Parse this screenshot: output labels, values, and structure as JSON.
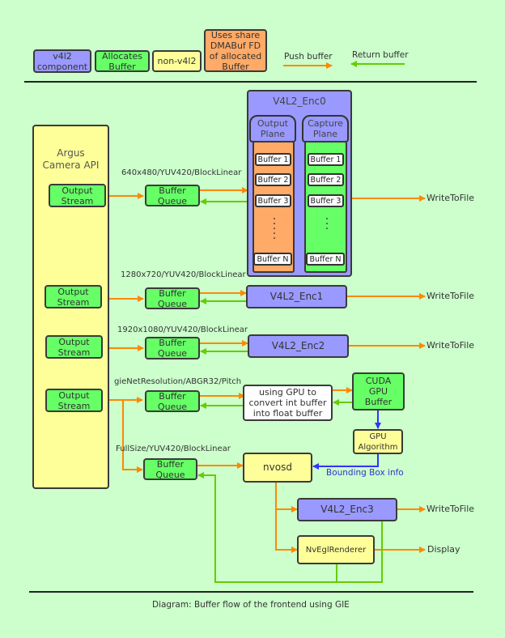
{
  "legend": {
    "v4l2": "v4l2\ncomponent",
    "allocates": "Allocates\nBuffer",
    "non_v4l2": "non-v4l2",
    "dmabuf": "Uses share\nDMABuf FD\nof allocated\nBuffer",
    "push": "Push buffer",
    "return": "Return buffer"
  },
  "colors": {
    "background": "#ccffcc",
    "v4l2": "#9999ff",
    "allocates": "#66ff66",
    "non_v4l2": "#ffff99",
    "dmabuf": "#ffaa66",
    "push_arrow": "#ff8800",
    "return_arrow": "#66cc00",
    "info_arrow": "#3333ff"
  },
  "argus": {
    "title": "Argus\nCamera API",
    "streams": [
      "Output\nStream",
      "Output\nStream",
      "Output\nStream",
      "Output\nStream"
    ]
  },
  "buffer_queue": "Buffer\nQueue",
  "formats": [
    "640x480/YUV420/BlockLinear",
    "1280x720/YUV420/BlockLinear",
    "1920x1080/YUV420/BlockLinear",
    "gieNetResolution/ABGR32/Pitch",
    "FullSize/YUV420/BlockLinear"
  ],
  "enc0": {
    "title": "V4L2_Enc0",
    "output_plane": "Output\nPlane",
    "capture_plane": "Capture\nPlane",
    "buffers": [
      "Buffer 1",
      "Buffer 2",
      "Buffer 3",
      "Buffer N"
    ],
    "ellipsis": "⋮"
  },
  "encoders": [
    "V4L2_Enc1",
    "V4L2_Enc2",
    "V4L2_Enc3"
  ],
  "write_to_file": "WriteToFile",
  "display": "Display",
  "gpu_convert": "using GPU to\nconvert int buffer\ninto float buffer",
  "cuda": "CUDA\nGPU\nBuffer",
  "gpu_algorithm": "GPU\nAlgorithm",
  "bbox_info": "Bounding Box info",
  "nvosd": "nvosd",
  "renderer": "NvEglRenderer",
  "caption": "Diagram: Buffer flow of the frontend using GIE"
}
